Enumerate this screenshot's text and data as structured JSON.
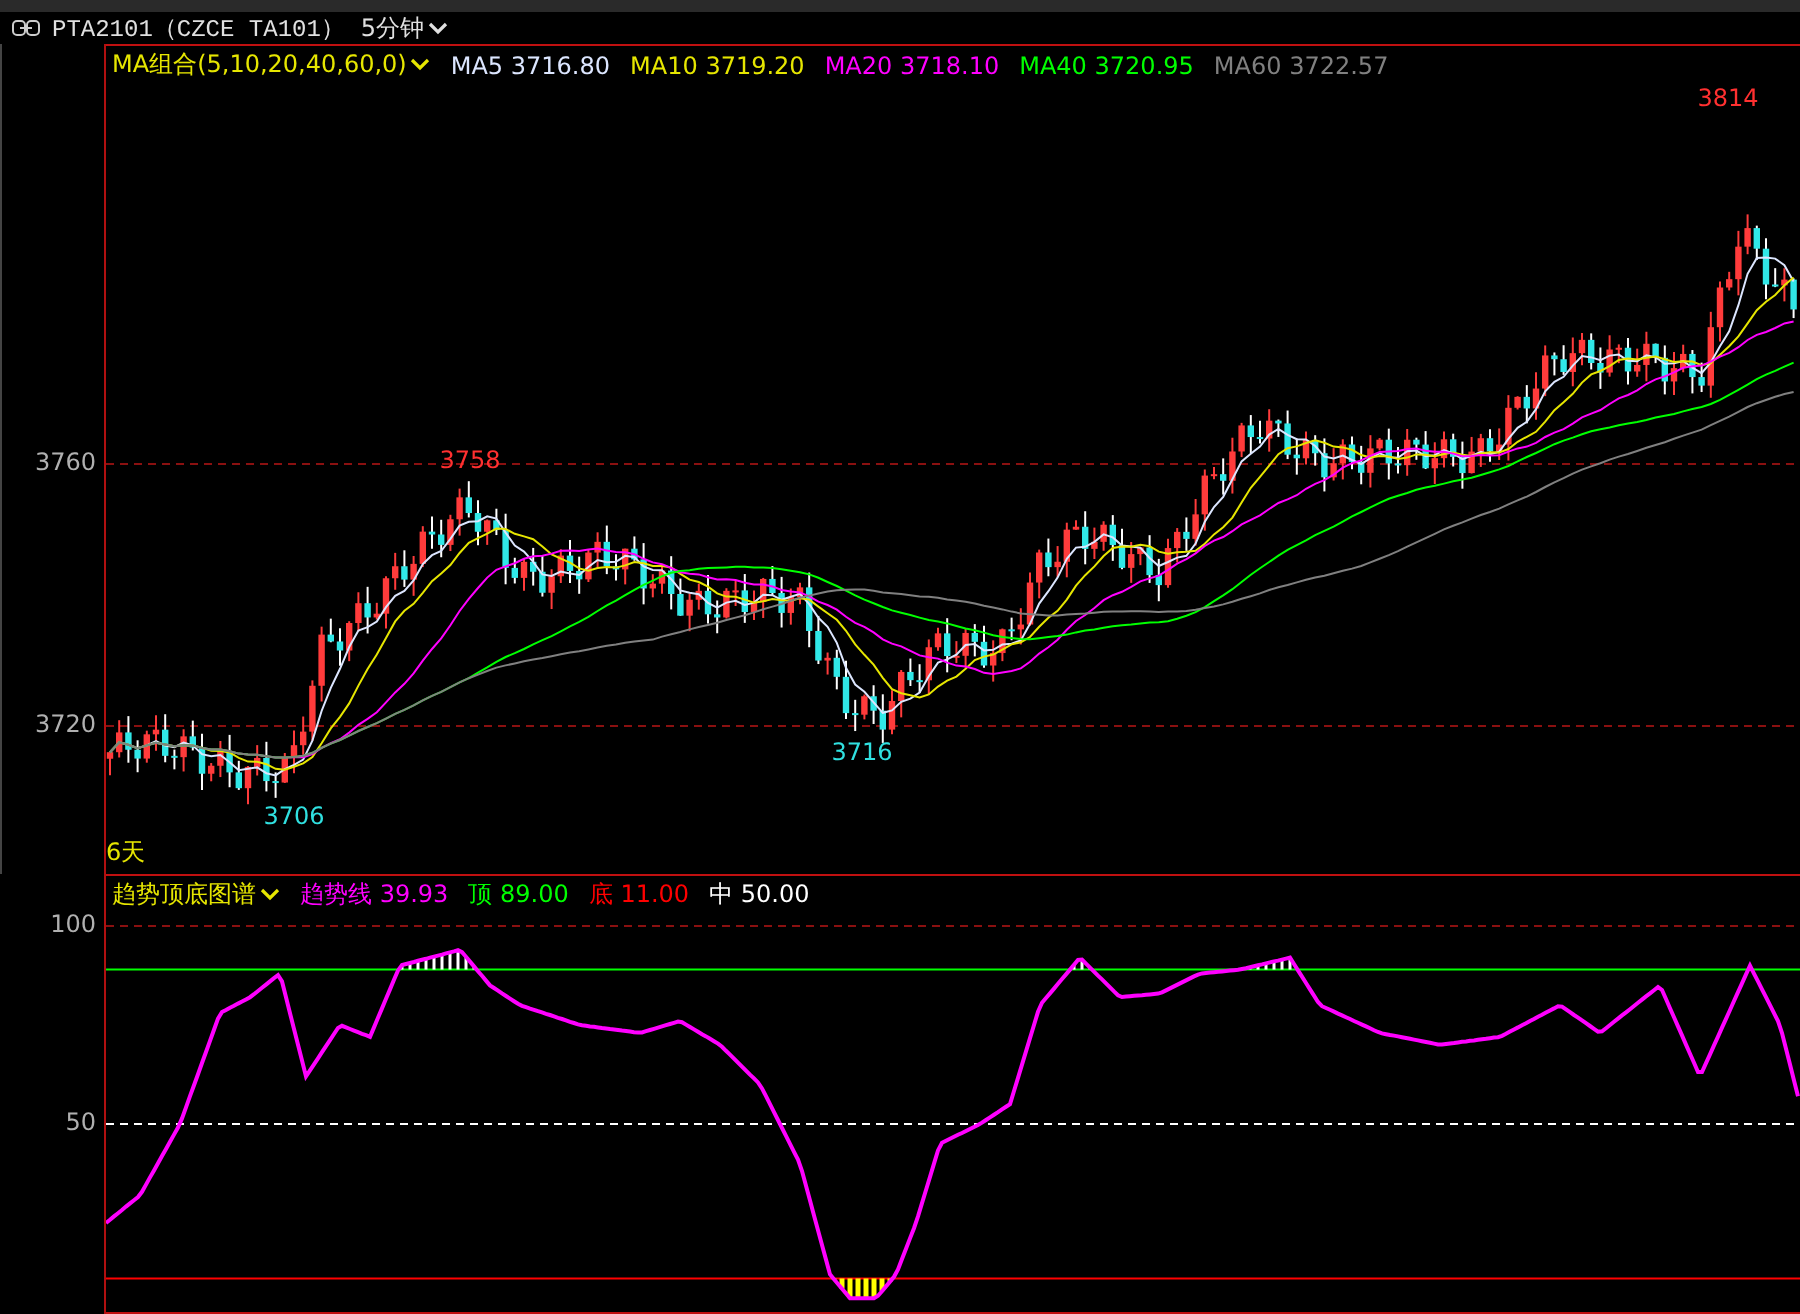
{
  "header": {
    "symbol": "PTA2101（CZCE TA101）",
    "period": "5分钟"
  },
  "main_panel": {
    "indicator": "MA组合(5,10,20,40,60,0)",
    "ma_values": [
      {
        "label": "MA5",
        "value": "3716.80",
        "color": "#dce6ff"
      },
      {
        "label": "MA10",
        "value": "3719.20",
        "color": "#e6e600"
      },
      {
        "label": "MA20",
        "value": "3718.10",
        "color": "#ff00ff"
      },
      {
        "label": "MA40",
        "value": "3720.95",
        "color": "#00ff00"
      },
      {
        "label": "MA60",
        "value": "3722.57",
        "color": "#808080"
      }
    ],
    "y_axis_labels": [
      "3760",
      "3720"
    ],
    "price_labels": [
      {
        "text": "3814",
        "kind": "high"
      },
      {
        "text": "3758",
        "kind": "high"
      },
      {
        "text": "3706",
        "kind": "low"
      },
      {
        "text": "3716",
        "kind": "low"
      }
    ],
    "period_note": "6天"
  },
  "sub_panel": {
    "indicator": "趋势顶底图谱",
    "values": [
      {
        "label": "趋势线",
        "value": "39.93",
        "color": "#ff00ff",
        "kind": "line"
      },
      {
        "label": "顶",
        "value": "89.00",
        "color": "#00ff00",
        "kind": "top"
      },
      {
        "label": "底",
        "value": "11.00",
        "color": "#ff0000",
        "kind": "bottom"
      },
      {
        "label": "中",
        "value": "50.00",
        "color": "#ffffff",
        "kind": "middle"
      }
    ],
    "y_axis_labels": [
      "100",
      "50"
    ]
  }
}
